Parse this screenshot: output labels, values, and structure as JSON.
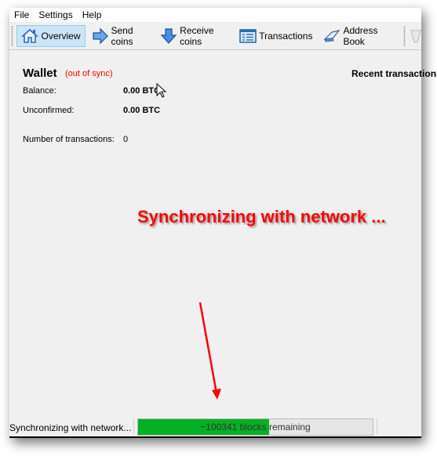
{
  "menu": [
    "File",
    "Settings",
    "Help"
  ],
  "toolbar": {
    "items": [
      {
        "label": "Overview",
        "icon": "home-icon",
        "active": true
      },
      {
        "label": "Send coins",
        "icon": "send-arrow-icon",
        "active": false
      },
      {
        "label": "Receive coins",
        "icon": "receive-arrow-icon",
        "active": false
      },
      {
        "label": "Transactions",
        "icon": "transactions-list-icon",
        "active": false
      },
      {
        "label": "Address Book",
        "icon": "address-book-icon",
        "active": false
      }
    ]
  },
  "wallet": {
    "title": "Wallet",
    "sync_state": "(out of sync)",
    "balance_label": "Balance:",
    "balance_value": "0.00 BTC",
    "unconfirmed_label": "Unconfirmed:",
    "unconfirmed_value": "0.00 BTC",
    "num_tx_label": "Number of transactions:",
    "num_tx_value": "0"
  },
  "recent_transactions": "Recent transactions",
  "annotation": "Synchronizing with network ...",
  "status": {
    "text": "Synchronizing with network...",
    "progress_label": "~100341 blocks remaining",
    "progress_percent": 56,
    "progress_color": "#06b025"
  }
}
